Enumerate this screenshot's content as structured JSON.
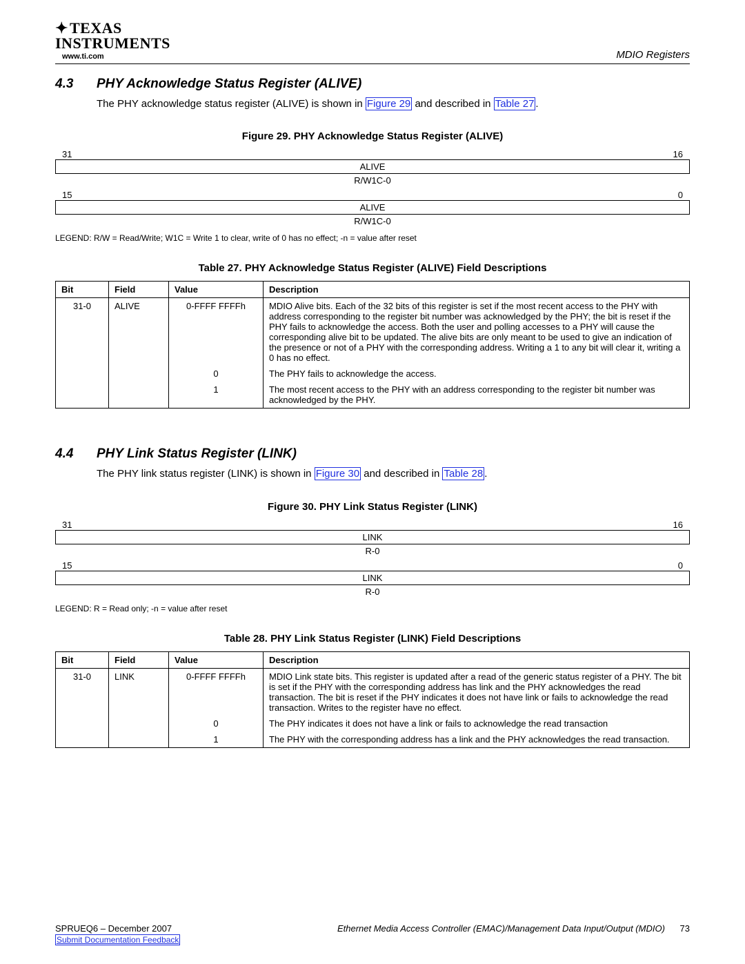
{
  "header": {
    "logo_line1": "TEXAS",
    "logo_line2": "INSTRUMENTS",
    "www": "www.ti.com",
    "right": "MDIO Registers"
  },
  "section43": {
    "num": "4.3",
    "title": "PHY Acknowledge Status Register (ALIVE)",
    "intro_pre": "The PHY acknowledge status register (ALIVE) is shown in ",
    "fig_ref": "Figure 29",
    "intro_mid": " and described in ",
    "tbl_ref": "Table 27",
    "intro_post": "."
  },
  "fig29": {
    "title": "Figure 29. PHY Acknowledge Status Register (ALIVE)",
    "hi_left": "31",
    "hi_right": "16",
    "hi_name": "ALIVE",
    "hi_attr": "R/W1C-0",
    "lo_left": "15",
    "lo_right": "0",
    "lo_name": "ALIVE",
    "lo_attr": "R/W1C-0",
    "legend": "LEGEND: R/W = Read/Write; W1C = Write 1 to clear, write of 0 has no effect; -n = value after reset"
  },
  "tbl27": {
    "title": "Table 27. PHY Acknowledge Status Register (ALIVE) Field Descriptions",
    "headers": {
      "bit": "Bit",
      "field": "Field",
      "value": "Value",
      "desc": "Description"
    },
    "rows": [
      {
        "bit": "31-0",
        "field": "ALIVE",
        "value": "0-FFFF FFFFh",
        "desc": "MDIO Alive bits. Each of the 32 bits of this register is set if the most recent access to the PHY with address corresponding to the register bit number was acknowledged by the PHY; the bit is reset if the PHY fails to acknowledge the access. Both the user and polling accesses to a PHY will cause the corresponding alive bit to be updated. The alive bits are only meant to be used to give an indication of the presence or not of a PHY with the corresponding address. Writing a 1 to any bit will clear it, writing a 0 has no effect."
      },
      {
        "bit": "",
        "field": "",
        "value": "0",
        "desc": "The PHY fails to acknowledge the access."
      },
      {
        "bit": "",
        "field": "",
        "value": "1",
        "desc": "The most recent access to the PHY with an address corresponding to the register bit number was acknowledged by the PHY."
      }
    ]
  },
  "section44": {
    "num": "4.4",
    "title": "PHY Link Status Register (LINK)",
    "intro_pre": "The PHY link status register (LINK) is shown in ",
    "fig_ref": "Figure 30",
    "intro_mid": " and described in ",
    "tbl_ref": "Table 28",
    "intro_post": "."
  },
  "fig30": {
    "title": "Figure 30. PHY Link Status Register (LINK)",
    "hi_left": "31",
    "hi_right": "16",
    "hi_name": "LINK",
    "hi_attr": "R-0",
    "lo_left": "15",
    "lo_right": "0",
    "lo_name": "LINK",
    "lo_attr": "R-0",
    "legend": "LEGEND: R = Read only; -n = value after reset"
  },
  "tbl28": {
    "title": "Table 28. PHY Link Status Register (LINK) Field Descriptions",
    "headers": {
      "bit": "Bit",
      "field": "Field",
      "value": "Value",
      "desc": "Description"
    },
    "rows": [
      {
        "bit": "31-0",
        "field": "LINK",
        "value": "0-FFFF FFFFh",
        "desc": "MDIO Link state bits. This register is updated after a read of the generic status register of a PHY. The bit is set if the PHY with the corresponding address has link and the PHY acknowledges the read transaction. The bit is reset if the PHY indicates it does not have link or fails to acknowledge the read transaction. Writes to the register have no effect."
      },
      {
        "bit": "",
        "field": "",
        "value": "0",
        "desc": "The PHY indicates it does not have a link or fails to acknowledge the read transaction"
      },
      {
        "bit": "",
        "field": "",
        "value": "1",
        "desc": "The PHY with the corresponding address has a link and the PHY acknowledges the read transaction."
      }
    ]
  },
  "footer": {
    "docnum": "SPRUEQ6 – December 2007",
    "title": "Ethernet Media Access Controller (EMAC)/Management Data Input/Output (MDIO)",
    "page": "73",
    "feedback": "Submit Documentation Feedback"
  }
}
